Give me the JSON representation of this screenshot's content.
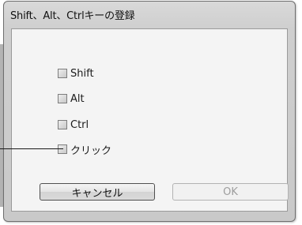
{
  "window": {
    "title": "Shift、Alt、Ctrlキーの登録"
  },
  "checkboxes": [
    {
      "label": "Shift",
      "checked": false
    },
    {
      "label": "Alt",
      "checked": false
    },
    {
      "label": "Ctrl",
      "checked": false
    },
    {
      "label": "クリック",
      "checked": false
    }
  ],
  "buttons": {
    "cancel_label": "キャンセル",
    "ok_label": "OK",
    "ok_enabled": false
  },
  "colors": {
    "dialog_bg": "#cfcfcf",
    "client_bg": "#f4f4f4",
    "disabled_text": "#9d9d9d"
  }
}
